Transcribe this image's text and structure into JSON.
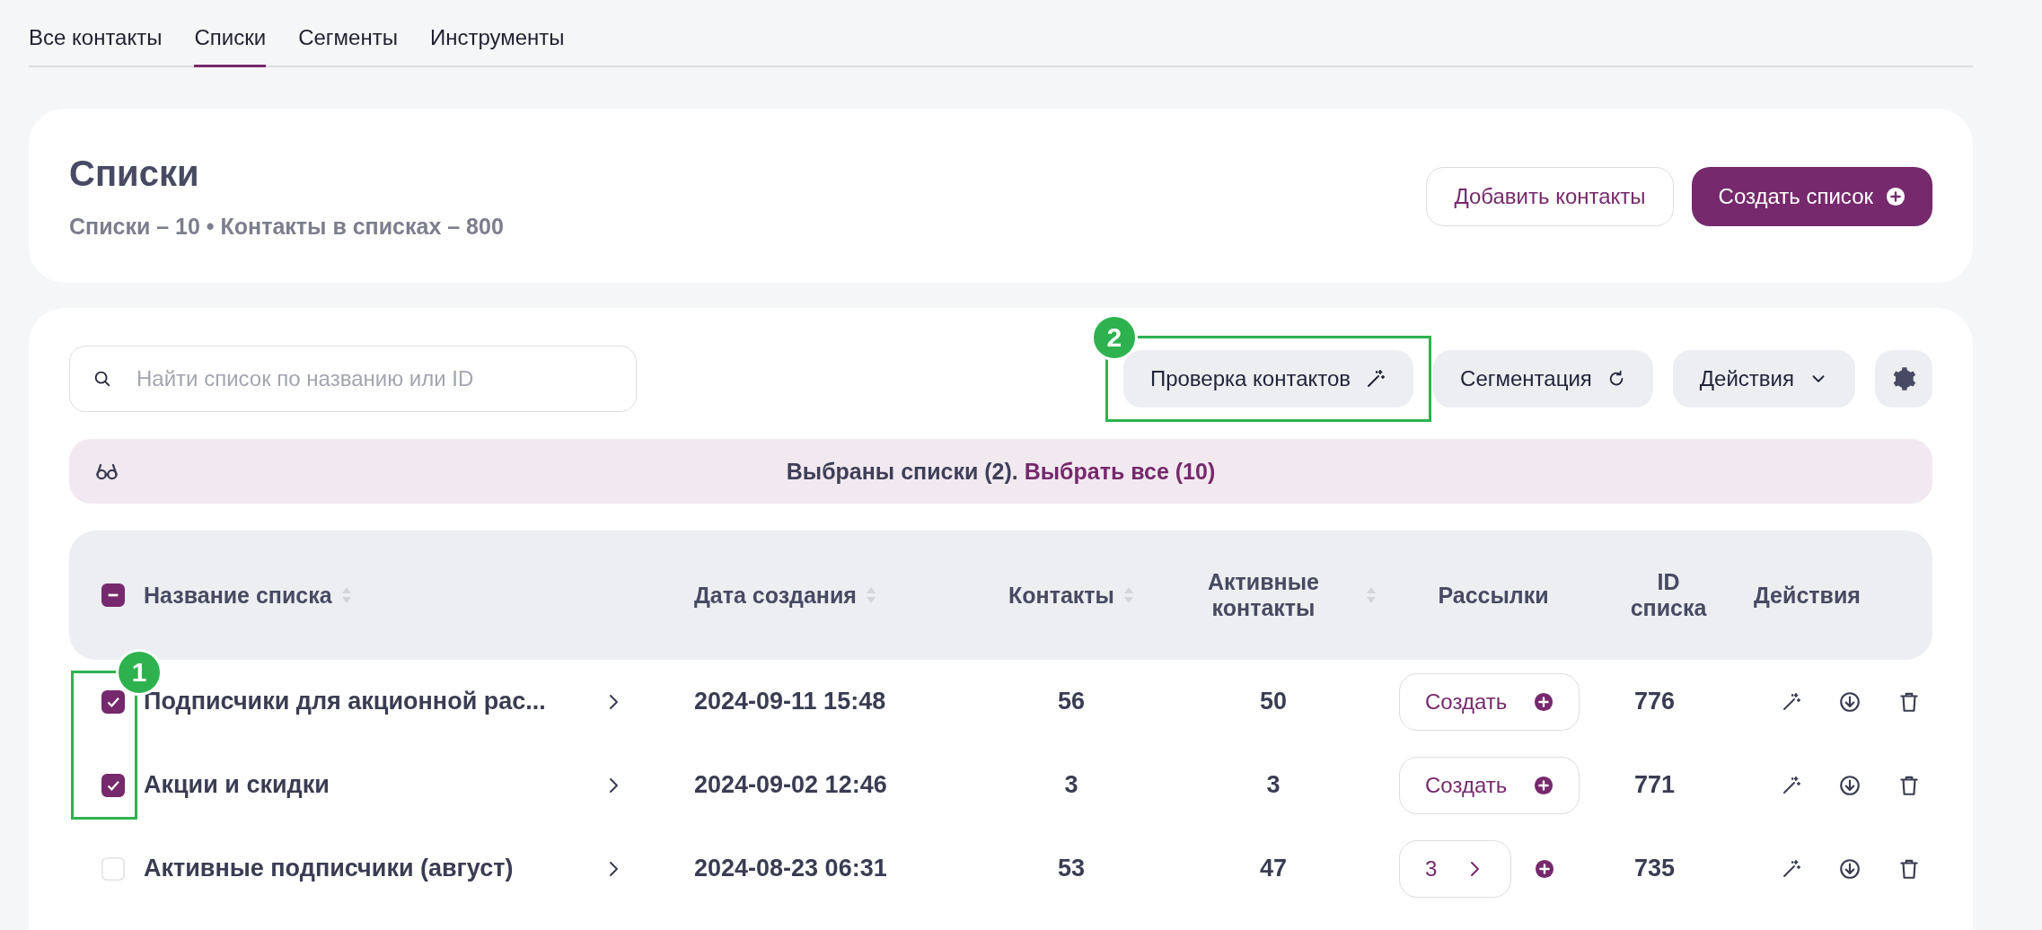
{
  "tabs": [
    {
      "label": "Все контакты",
      "selected": false
    },
    {
      "label": "Списки",
      "selected": true
    },
    {
      "label": "Сегменты",
      "selected": false
    },
    {
      "label": "Инструменты",
      "selected": false
    }
  ],
  "header": {
    "title": "Списки",
    "subtitle": "Списки – 10 • Контакты в списках – 800",
    "buttons": [
      {
        "label": "Добавить контакты",
        "kind": "outline"
      },
      {
        "label": "Создать список",
        "kind": "primary"
      }
    ]
  },
  "search": {
    "placeholder": "Найти список по названию или ID"
  },
  "toolbar": [
    {
      "label": "Проверка контактов",
      "kind": "check",
      "callout": "2"
    },
    {
      "label": "Сегментация",
      "kind": "segment"
    },
    {
      "label": "Действия",
      "kind": "menu"
    },
    {
      "kind": "settings"
    }
  ],
  "selection_bar": {
    "text": "Выбраны списки (2).",
    "link": "Выбрать все (10)"
  },
  "table": {
    "select_all": {
      "indeterminate": true
    },
    "callout": "1",
    "columns": [
      {
        "label": "Название списка",
        "sortable": true
      },
      {
        "label": "Дата создания",
        "sortable": true
      },
      {
        "label": "Контакты",
        "sortable": true
      },
      {
        "label": "Активные контакты",
        "sortable": true
      },
      {
        "label": "Рассылки",
        "sortable": false
      },
      {
        "label": "ID списка",
        "sortable": false
      },
      {
        "label": "Действия",
        "sortable": false
      }
    ],
    "rows": [
      {
        "selected": true,
        "name": "Подписчики для акционной рас...",
        "date": "2024-09-11 15:48",
        "contacts": "56",
        "active": "50",
        "mailings": {
          "kind": "create",
          "label": "Создать"
        },
        "id": "776"
      },
      {
        "selected": true,
        "name": "Акции и скидки",
        "date": "2024-09-02 12:46",
        "contacts": "3",
        "active": "3",
        "mailings": {
          "kind": "create",
          "label": "Создать"
        },
        "id": "771"
      },
      {
        "selected": false,
        "name": "Активные подписчики (август)",
        "date": "2024-08-23 06:31",
        "contacts": "53",
        "active": "47",
        "mailings": {
          "kind": "count",
          "label": "3"
        },
        "id": "735"
      }
    ]
  }
}
